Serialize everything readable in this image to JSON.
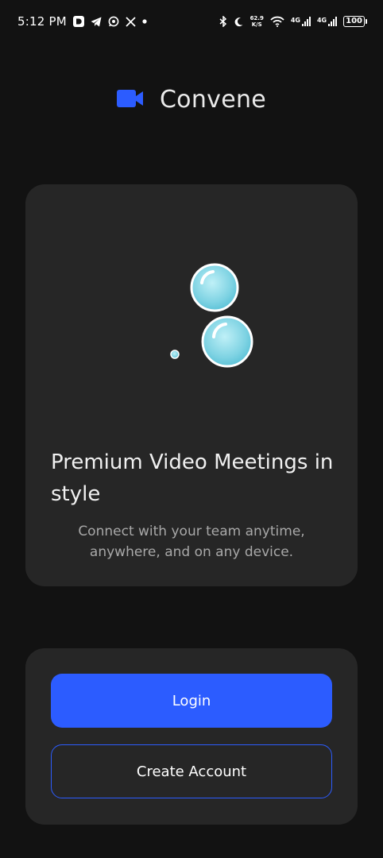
{
  "status_bar": {
    "time": "5:12 PM",
    "net_speed_value": "62.9",
    "net_speed_unit": "K/S",
    "signal1_label": "4G",
    "signal2_label": "4G",
    "battery": "100"
  },
  "brand": {
    "name": "Convene",
    "accent_color": "#2c5cff"
  },
  "hero": {
    "title": "Premium Video Meetings in style",
    "subtitle": "Connect with your team anytime, anywhere, and on any device."
  },
  "auth": {
    "login_label": "Login",
    "create_account_label": "Create Account"
  },
  "icons": {
    "status_left": [
      "d-app-icon",
      "telegram-icon",
      "whatsapp-icon",
      "x-icon",
      "dot-icon"
    ],
    "status_right": [
      "bluetooth-icon",
      "moon-icon",
      "wifi-icon"
    ],
    "brand": "video-camera-icon"
  }
}
